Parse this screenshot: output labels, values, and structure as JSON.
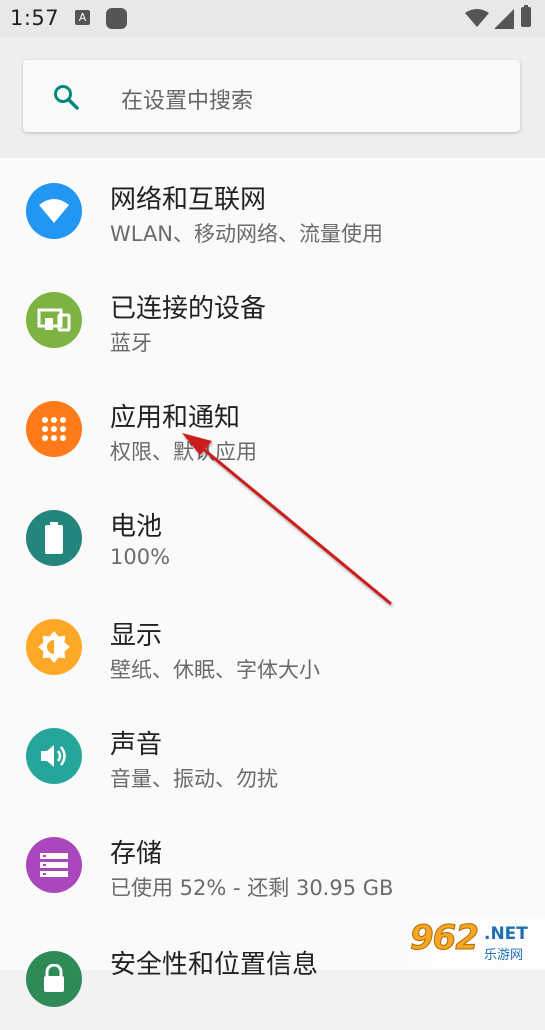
{
  "status_bar": {
    "time": "1:57",
    "notification_letter": "A",
    "icons": [
      "notification-a-icon",
      "notification-square-icon",
      "wifi-icon",
      "signal-icon",
      "battery-icon"
    ]
  },
  "search": {
    "placeholder": "在设置中搜索",
    "icon": "search-icon",
    "accent": "#00897b"
  },
  "items": [
    {
      "title": "网络和互联网",
      "subtitle": "WLAN、移动网络、流量使用",
      "icon": "wifi-icon",
      "color": "#2196f3"
    },
    {
      "title": "已连接的设备",
      "subtitle": "蓝牙",
      "icon": "devices-icon",
      "color": "#7cb342"
    },
    {
      "title": "应用和通知",
      "subtitle": "权限、默认应用",
      "icon": "apps-icon",
      "color": "#ff7a19"
    },
    {
      "title": "电池",
      "subtitle": "100%",
      "icon": "battery-icon",
      "color": "#23857b"
    },
    {
      "title": "显示",
      "subtitle": "壁纸、休眠、字体大小",
      "icon": "brightness-icon",
      "color": "#ffa726"
    },
    {
      "title": "声音",
      "subtitle": "音量、振动、勿扰",
      "icon": "volume-icon",
      "color": "#26a69a"
    },
    {
      "title": "存储",
      "subtitle": "已使用 52% - 还剩 30.95 GB",
      "icon": "storage-icon",
      "color": "#ab47bc"
    },
    {
      "title": "安全性和位置信息",
      "subtitle": "",
      "icon": "lock-icon",
      "color": "#2e8b57"
    }
  ],
  "annotation": {
    "color": "#cc1f1f",
    "icon": "red-arrow"
  },
  "watermark": {
    "logo": "962",
    "suffix": ".NET",
    "sub": "乐游网"
  }
}
